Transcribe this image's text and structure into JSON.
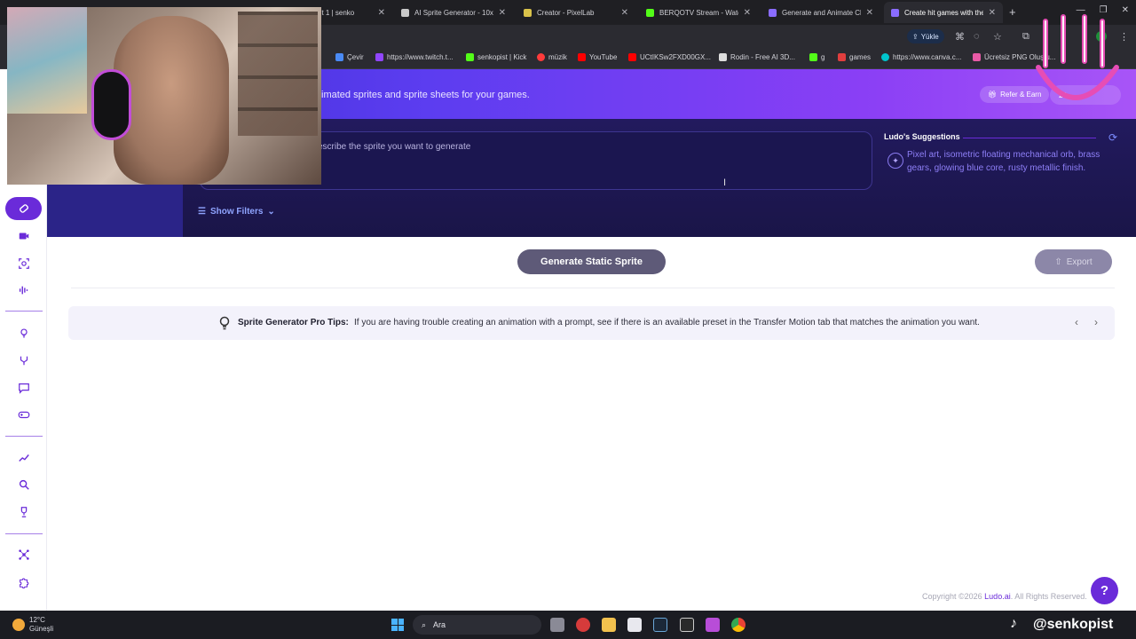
{
  "browser": {
    "tabs": [
      {
        "label": "et 1 | senko",
        "favcolor": "#e33"
      },
      {
        "label": "AI Sprite Generator - 10x",
        "favcolor": "#c9c9c9"
      },
      {
        "label": "Creator - PixelLab",
        "favcolor": "#d9c24a"
      },
      {
        "label": "BERQOTV Stream - Watch",
        "favcolor": "#53fc18"
      },
      {
        "label": "Generate and Animate Ch",
        "favcolor": "#8a6cff"
      },
      {
        "label": "Create hit games with the",
        "favcolor": "#8a6cff"
      }
    ],
    "upload_label": "Yükle",
    "profile_initial": "K",
    "bookmarks": [
      {
        "label": "Çevir",
        "color": "#4a8af4"
      },
      {
        "label": "https://www.twitch.t...",
        "color": "#9146ff"
      },
      {
        "label": "senkopist | Kick",
        "color": "#53fc18"
      },
      {
        "label": "müzik",
        "color": "#ff3b3b"
      },
      {
        "label": "YouTube",
        "color": "#ff0000"
      },
      {
        "label": "UCtIKSw2FXD00GX...",
        "color": "#ff0000"
      },
      {
        "label": "Rodin - Free AI 3D...",
        "color": "#dddddd"
      },
      {
        "label": "g",
        "color": "#53fc18"
      },
      {
        "label": "games",
        "color": "#e03e3e"
      },
      {
        "label": "https://www.canva.c...",
        "color": "#00c4cc"
      },
      {
        "label": "Ücretsiz PNG Oluştu...",
        "color": "#e85aa6"
      }
    ]
  },
  "hero": {
    "subtitle": "imated sprites and sprite sheets for your games.",
    "refer_label": "Refer & Earn",
    "right_badge": "20"
  },
  "prompt": {
    "placeholder": "escribe the sprite you want to generate"
  },
  "filters_label": "Show Filters",
  "suggestions": {
    "title": "Ludo's Suggestions",
    "text": "Pixel art, isometric floating mechanical orb, brass gears, glowing blue core, rusty metallic finish."
  },
  "actions": {
    "generate_label": "Generate Static Sprite",
    "export_label": "Export"
  },
  "tips": {
    "title": "Sprite Generator Pro Tips:",
    "text": "If you are having trouble creating an animation with a prompt, see if there is an available preset in the Transfer Motion tab that matches the animation you want."
  },
  "footer": {
    "prefix": "Copyright ©2026 ",
    "brand": "Ludo.ai",
    "suffix": ". All Rights Reserved."
  },
  "help_label": "?",
  "taskbar": {
    "temperature": "12°C",
    "weather": "Güneşli",
    "search_label": "Ara"
  },
  "watermark": {
    "handle": "@senkopist"
  },
  "colors": {
    "accent": "#6a2bd9",
    "hero_start": "#3b2cd3",
    "hero_end": "#a855f7",
    "panel": "#1a1548"
  }
}
